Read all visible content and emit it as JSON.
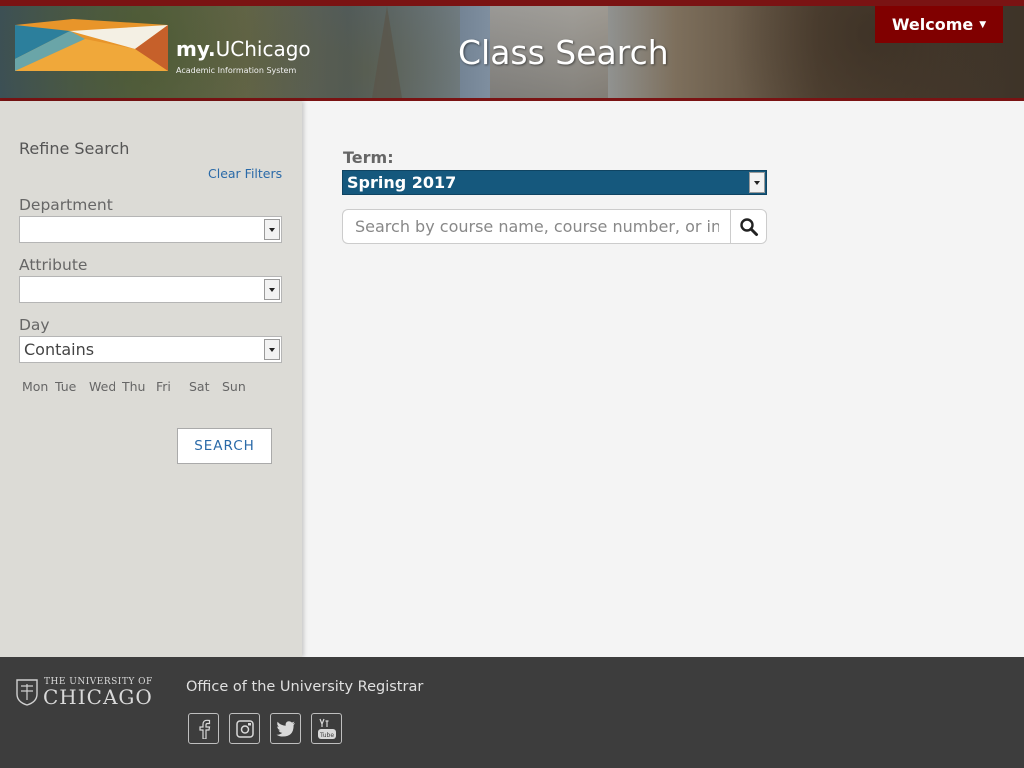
{
  "header": {
    "brand_prefix": "my.",
    "brand_name": "UChicago",
    "brand_subtitle": "Academic Information System",
    "title": "Class Search",
    "welcome_label": "Welcome"
  },
  "sidebar": {
    "title": "Refine Search",
    "clear_filters": "Clear Filters",
    "department_label": "Department",
    "department_value": "",
    "attribute_label": "Attribute",
    "attribute_value": "",
    "day_label": "Day",
    "day_value": "Contains",
    "days": [
      "Mon",
      "Tue",
      "Wed",
      "Thu",
      "Fri",
      "Sat",
      "Sun"
    ],
    "search_button": "SEARCH"
  },
  "main": {
    "term_label": "Term:",
    "term_value": "Spring 2017",
    "search_placeholder": "Search by course name, course number, or in"
  },
  "footer": {
    "university_line1": "THE UNIVERSITY OF",
    "university_line2": "CHICAGO",
    "office": "Office of the University Registrar",
    "social": [
      "facebook-icon",
      "instagram-icon",
      "twitter-icon",
      "youtube-icon"
    ]
  },
  "colors": {
    "maroon": "#800000",
    "term_blue": "#15587d",
    "link_blue": "#2a6aa8",
    "sidebar_bg": "#dcdbd6",
    "footer_bg": "#3d3d3d"
  }
}
